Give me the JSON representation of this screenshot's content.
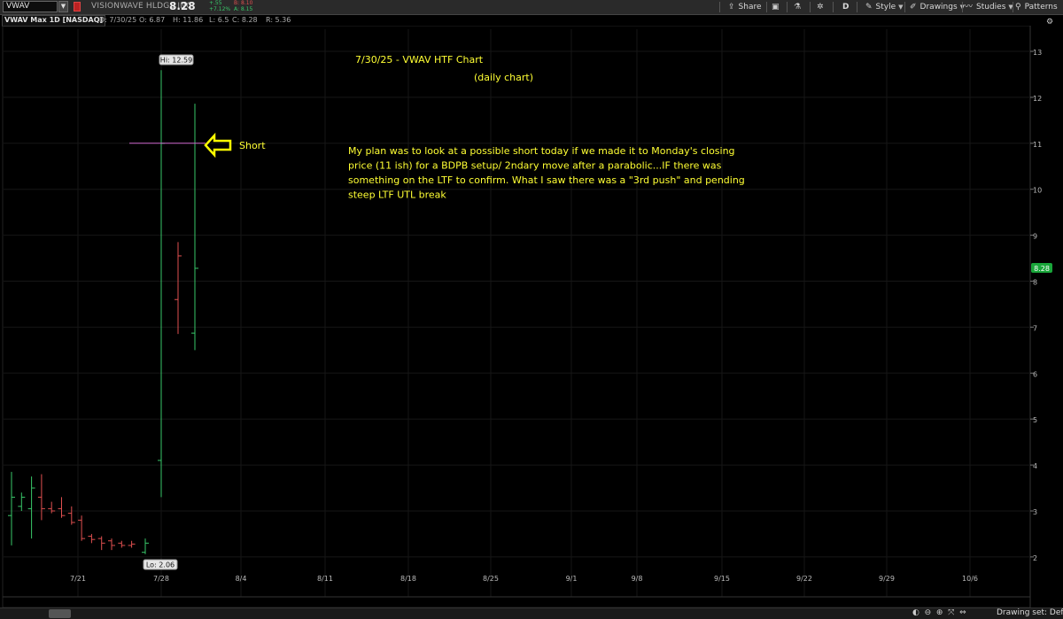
{
  "toolbar": {
    "symbol": "VWAV",
    "company": "VISIONWAVE HLDGS INC",
    "last": "8.28",
    "change_abs": "+.55",
    "change_pct": "+7.12%",
    "bid": "B: 8.10",
    "ask": "A: 8.15",
    "share_label": "Share",
    "aggregation_label": "D",
    "style_label": "Style",
    "drawings_label": "Drawings",
    "studies_label": "Studies",
    "patterns_label": "Patterns"
  },
  "header": {
    "title": "VWAV Max 1D [NASDAQ]",
    "date": "D: 7/30/25",
    "open": "O: 6.87",
    "high": "H: 11.86",
    "low": "L: 6.5",
    "close": "C: 8.28",
    "range": "R: 5.36"
  },
  "footer": {
    "drawing_set": "Drawing set: Default"
  },
  "colors": {
    "up": "#39c86a",
    "down": "#e05050",
    "annotation": "#ffff33",
    "hline": "#cc66cc",
    "price_badge": "#19a63a"
  },
  "chart_data": {
    "type": "ohlc",
    "price_axis": {
      "ticks": [
        "2",
        "3",
        "4",
        "5",
        "6",
        "7",
        "8",
        "9",
        "10",
        "11",
        "12",
        "13"
      ],
      "range": [
        1.6,
        13.6
      ]
    },
    "date_axis": {
      "ticks": [
        "7/21",
        "7/28",
        "8/4",
        "8/11",
        "8/18",
        "8/25",
        "9/1",
        "9/8",
        "9/15",
        "9/22",
        "9/29",
        "10/6"
      ]
    },
    "bars": [
      {
        "o": 2.9,
        "h": 3.85,
        "l": 2.25,
        "c": 3.3,
        "up": true
      },
      {
        "o": 3.1,
        "h": 3.4,
        "l": 3.0,
        "c": 3.3,
        "up": true
      },
      {
        "o": 3.05,
        "h": 3.75,
        "l": 2.4,
        "c": 3.5,
        "up": true
      },
      {
        "o": 3.3,
        "h": 3.8,
        "l": 2.8,
        "c": 3.05,
        "up": false
      },
      {
        "o": 3.05,
        "h": 3.2,
        "l": 2.95,
        "c": 3.0,
        "up": false
      },
      {
        "o": 3.05,
        "h": 3.3,
        "l": 2.85,
        "c": 2.9,
        "up": false
      },
      {
        "o": 2.95,
        "h": 3.1,
        "l": 2.7,
        "c": 2.75,
        "up": false
      },
      {
        "o": 2.8,
        "h": 2.9,
        "l": 2.35,
        "c": 2.4,
        "up": false
      },
      {
        "o": 2.45,
        "h": 2.5,
        "l": 2.3,
        "c": 2.38,
        "up": false
      },
      {
        "o": 2.4,
        "h": 2.45,
        "l": 2.15,
        "c": 2.3,
        "up": false
      },
      {
        "o": 2.35,
        "h": 2.4,
        "l": 2.15,
        "c": 2.25,
        "up": false
      },
      {
        "o": 2.3,
        "h": 2.35,
        "l": 2.2,
        "c": 2.25,
        "up": false
      },
      {
        "o": 2.25,
        "h": 2.35,
        "l": 2.2,
        "c": 2.28,
        "up": false
      },
      {
        "o": 2.1,
        "h": 2.4,
        "l": 2.06,
        "c": 2.3,
        "up": true
      },
      {
        "o": 4.1,
        "h": 12.59,
        "l": 3.3,
        "c": 11.0,
        "up": true
      },
      {
        "o": 7.6,
        "h": 8.85,
        "l": 6.85,
        "c": 8.55,
        "up": false
      },
      {
        "o": 6.87,
        "h": 11.86,
        "l": 6.5,
        "c": 8.28,
        "up": true
      }
    ],
    "hi_label": "Hi: 12.59",
    "lo_label": "Lo: 2.06",
    "last_price": "8.28",
    "hline_price": 11.0,
    "annotations": {
      "title": "7/30/25 - VWAV HTF Chart",
      "subtitle": "(daily chart)",
      "arrow_label": "Short",
      "note_lines": [
        "My plan was to look at a possible short today if we made it to Monday's closing",
        "price (11 ish) for a BDPB setup/ 2ndary move after a parabolic...IF there was",
        "something on the LTF to confirm. What I saw there was a \"3rd push\" and pending",
        "steep LTF UTL break"
      ]
    }
  }
}
